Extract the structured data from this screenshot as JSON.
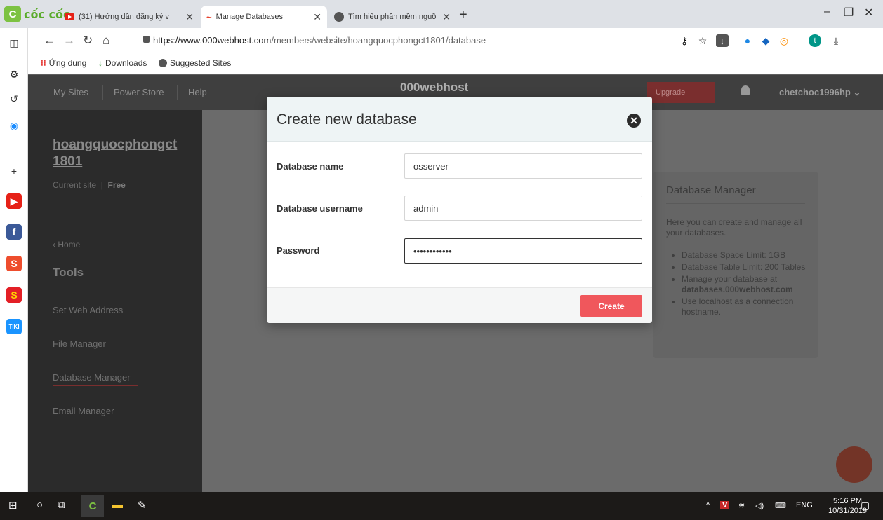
{
  "browser": {
    "brand": "cốc cốc",
    "tabs": [
      {
        "title": "(31) Hướng dẫn đăng ký v"
      },
      {
        "title": "Manage Databases"
      },
      {
        "title": "Tìm hiểu phần mềm nguồ"
      }
    ],
    "url_domain": "https://www.000webhost.com",
    "url_path": "/members/website/hoangquocphongct1801/database",
    "bookmarks": [
      "Ứng dụng",
      "Downloads",
      "Suggested Sites"
    ],
    "profile_initial": "t"
  },
  "site": {
    "nav": [
      "My Sites",
      "Power Store",
      "Help"
    ],
    "logo": "000webhost",
    "upgrade": "Upgrade",
    "user": "chetchoc1996hp",
    "sidebar": {
      "site_name": "hoangquocphongct 1801",
      "current_site": "Current site",
      "plan": "Free",
      "home": "Home",
      "tools": "Tools",
      "items": [
        "Set Web Address",
        "File Manager",
        "Database Manager",
        "Email Manager"
      ]
    },
    "db_manager": {
      "title": "Database Manager",
      "intro": "Here you can create and manage all your databases.",
      "bullets": [
        "Database Space Limit: 1GB",
        "Database Table Limit: 200 Tables",
        "Manage your database at",
        "Use localhost as a connection hostname."
      ],
      "bullet_link": "databases.000webhost.com"
    }
  },
  "modal": {
    "title": "Create new database",
    "fields": [
      {
        "label": "Database name",
        "value": "osserver"
      },
      {
        "label": "Database username",
        "value": "admin"
      },
      {
        "label": "Password",
        "value": "••••••••••••"
      }
    ],
    "create": "Create"
  },
  "taskbar": {
    "lang": "ENG",
    "time": "5:16 PM",
    "date": "10/31/2019"
  }
}
